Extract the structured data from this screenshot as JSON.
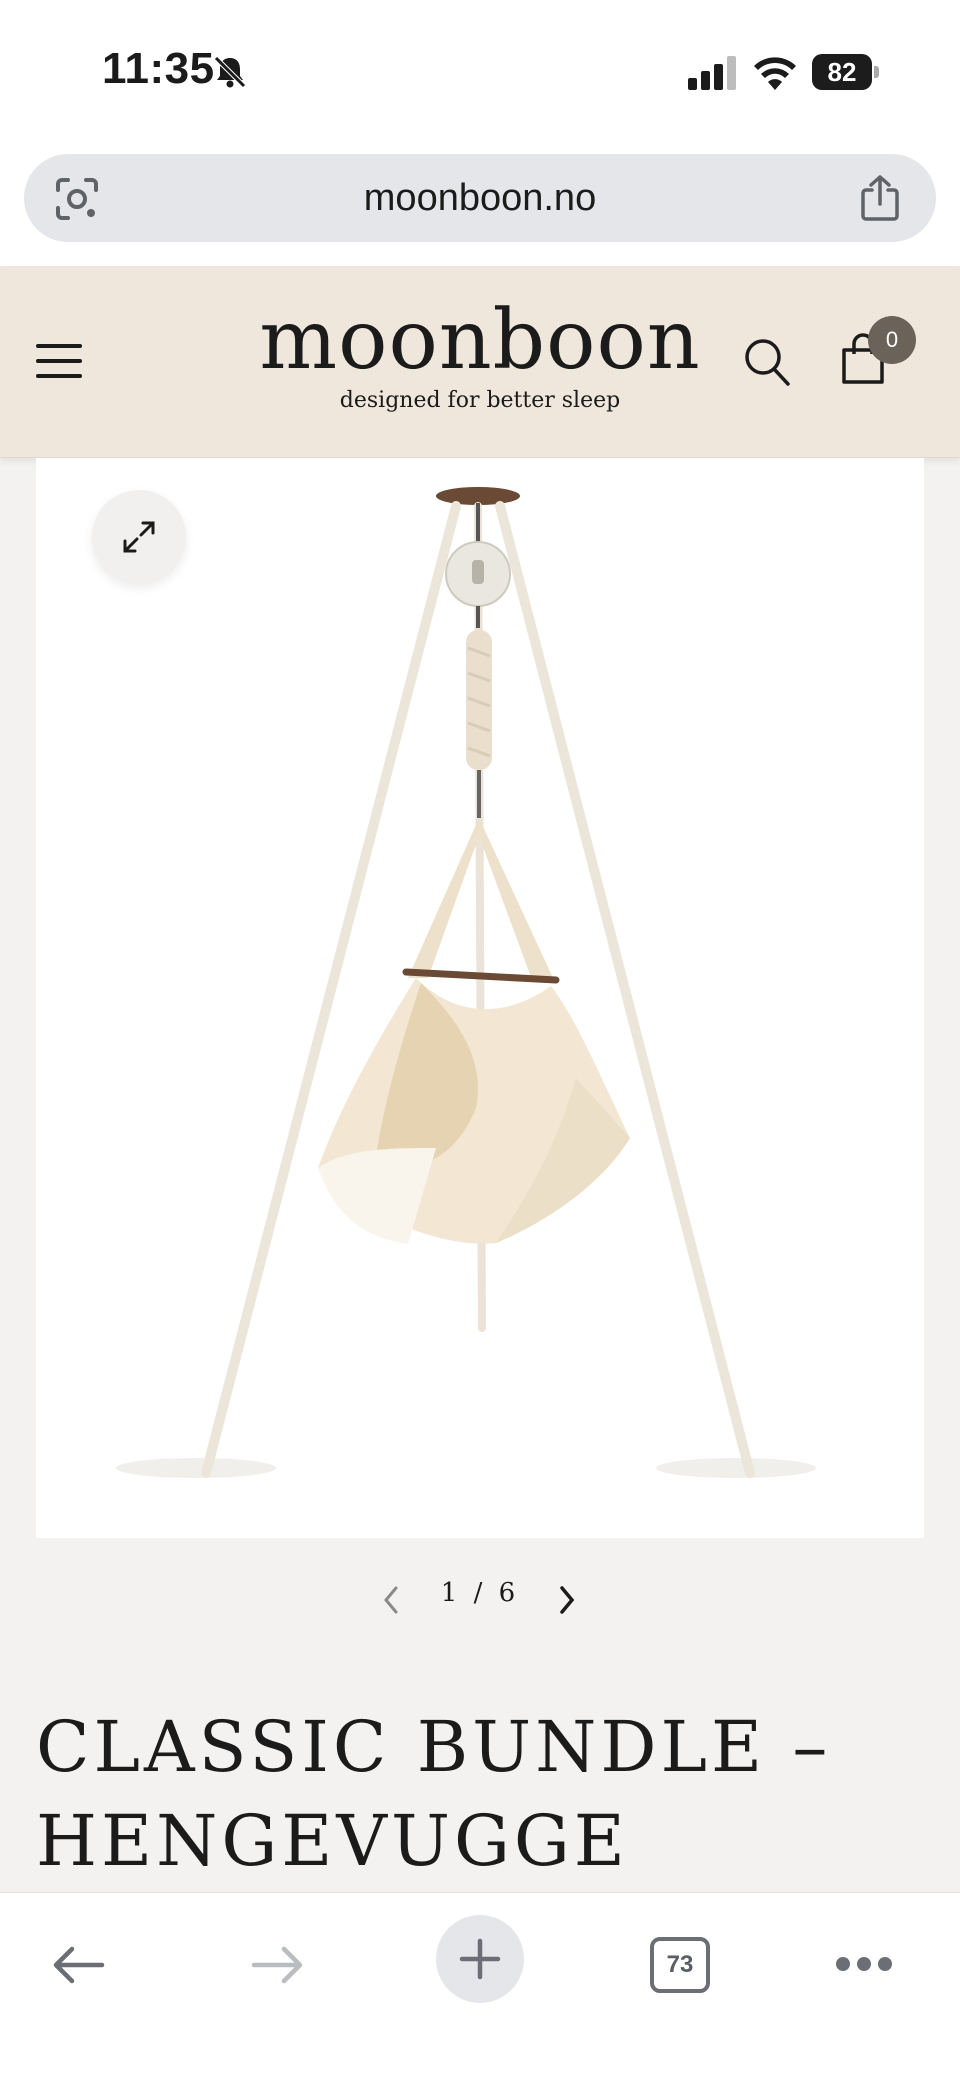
{
  "status_bar": {
    "time": "11:35",
    "battery": "82"
  },
  "browser": {
    "url": "moonboon.no",
    "tab_count": "73"
  },
  "site_header": {
    "logo": "moonboon",
    "tagline": "designed for better sleep",
    "cart_count": "0"
  },
  "gallery": {
    "current": "1",
    "separator": "/",
    "total": "6"
  },
  "product": {
    "title_line1": "CLASSIC BUNDLE –",
    "title_line2": "HENGEVUGGE"
  },
  "colors": {
    "header_bg": "#efe6dc",
    "page_bg": "#f3f2f0",
    "cart_badge": "#6b6259"
  }
}
